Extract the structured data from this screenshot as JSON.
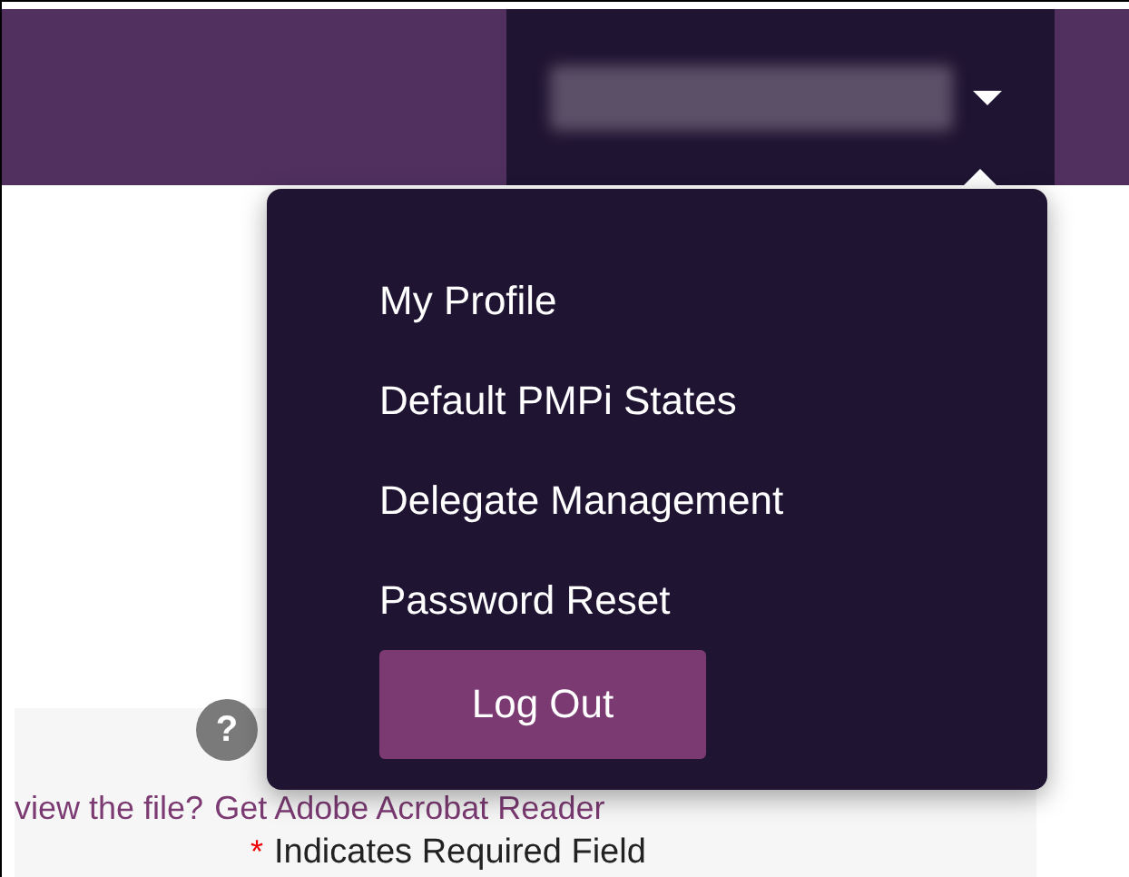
{
  "header": {
    "user_menu": {
      "expanded": true
    }
  },
  "dropdown": {
    "items": [
      {
        "label": "My Profile"
      },
      {
        "label": "Default PMPi States"
      },
      {
        "label": "Delegate Management"
      },
      {
        "label": "Password Reset"
      }
    ],
    "button": "Log Out"
  },
  "page": {
    "help_icon": "?",
    "reader_prompt": "view the file?",
    "reader_link": "Get Adobe Acrobat Reader",
    "required_mark": "*",
    "required_label": "Indicates Required Field"
  }
}
